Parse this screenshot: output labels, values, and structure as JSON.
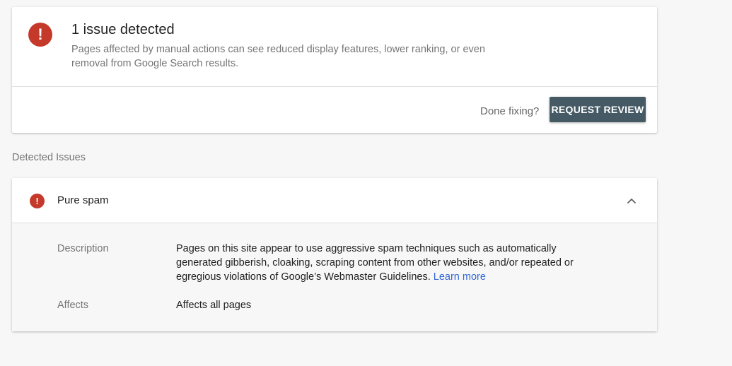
{
  "summary": {
    "icon": "alert-icon",
    "icon_glyph": "!",
    "title": "1 issue detected",
    "body": "Pages affected by manual actions can see reduced display features, lower ranking, or even removal from Google Search results.",
    "done_text": "Done fixing?",
    "button_label": "REQUEST REVIEW"
  },
  "detected_label": "Detected Issues",
  "issue": {
    "icon_glyph": "!",
    "title": "Pure spam",
    "expanded": true,
    "description_label": "Description",
    "description_text": "Pages on this site appear to use aggressive spam techniques such as automatically generated gibberish, cloaking, scraping content from other websites, and/or repeated or egregious violations of Google’s Webmaster Guidelines.",
    "learn_more": "Learn more",
    "affects_label": "Affects",
    "affects_text": "Affects all pages"
  },
  "colors": {
    "error_red": "#c5392b",
    "button_bg": "#455a64",
    "link_blue": "#3367d6"
  }
}
